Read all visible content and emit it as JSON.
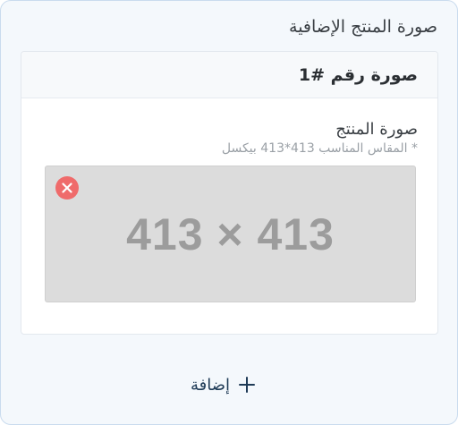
{
  "panel": {
    "title": "صورة المنتج الإضافية"
  },
  "card": {
    "title": "صورة رقم #1",
    "field_label": "صورة المنتج",
    "field_hint": "* المقاس المناسب 413*413 بيكسل",
    "image_placeholder": "413 × 413"
  },
  "icons": {
    "remove": "close-icon",
    "add": "plus-icon"
  },
  "actions": {
    "add_label": "إضافة"
  },
  "colors": {
    "remove_button": "#ef6b6b",
    "panel_background": "#f4f8fc",
    "panel_border": "#c9dbee",
    "add_text": "#1f3b57",
    "placeholder_bg": "#dcdcdc"
  }
}
